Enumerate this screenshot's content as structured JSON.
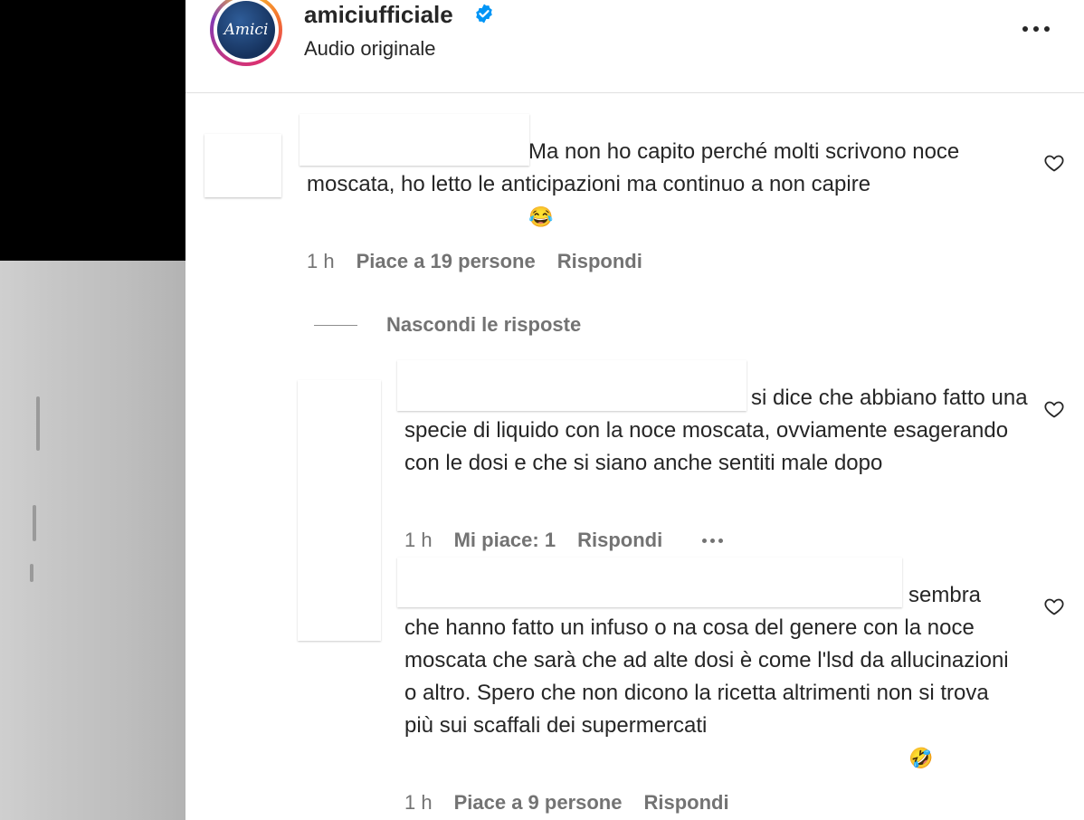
{
  "header": {
    "logo_text": "Amici",
    "username": "amiciufficiale",
    "subtitle": "Audio originale",
    "more_icon": "ellipsis-horizontal-icon",
    "verified_icon": "verified-badge-icon"
  },
  "comments": [
    {
      "text": "Ma non ho capito perché molti scrivono noce moscata, ho letto le anticipazioni ma continuo a non capire",
      "emoji": "😂",
      "time": "1 h",
      "likes": "Piace a 19 persone",
      "reply": "Rispondi"
    }
  ],
  "hide_replies": "Nascondi le risposte",
  "replies": [
    {
      "text": "si dice che abbiano fatto una specie di liquido con la noce moscata, ovviamente esagerando con le dosi e che si siano anche sentiti male dopo",
      "time": "1 h",
      "likes": "Mi piace: 1",
      "reply": "Rispondi"
    },
    {
      "text": "sembra che hanno fatto un infuso o na cosa del genere con la noce moscata che sarà che ad alte dosi è come l'lsd da allucinazioni o altro. Spero che non dicono la ricetta altrimenti non si trova più sui scaffali dei supermercati",
      "emoji": "🤣",
      "time": "1 h",
      "likes": "Piace a 9 persone",
      "reply": "Rispondi"
    }
  ],
  "colors": {
    "text": "#262626",
    "secondary": "#737373",
    "verified": "#0095f6"
  }
}
